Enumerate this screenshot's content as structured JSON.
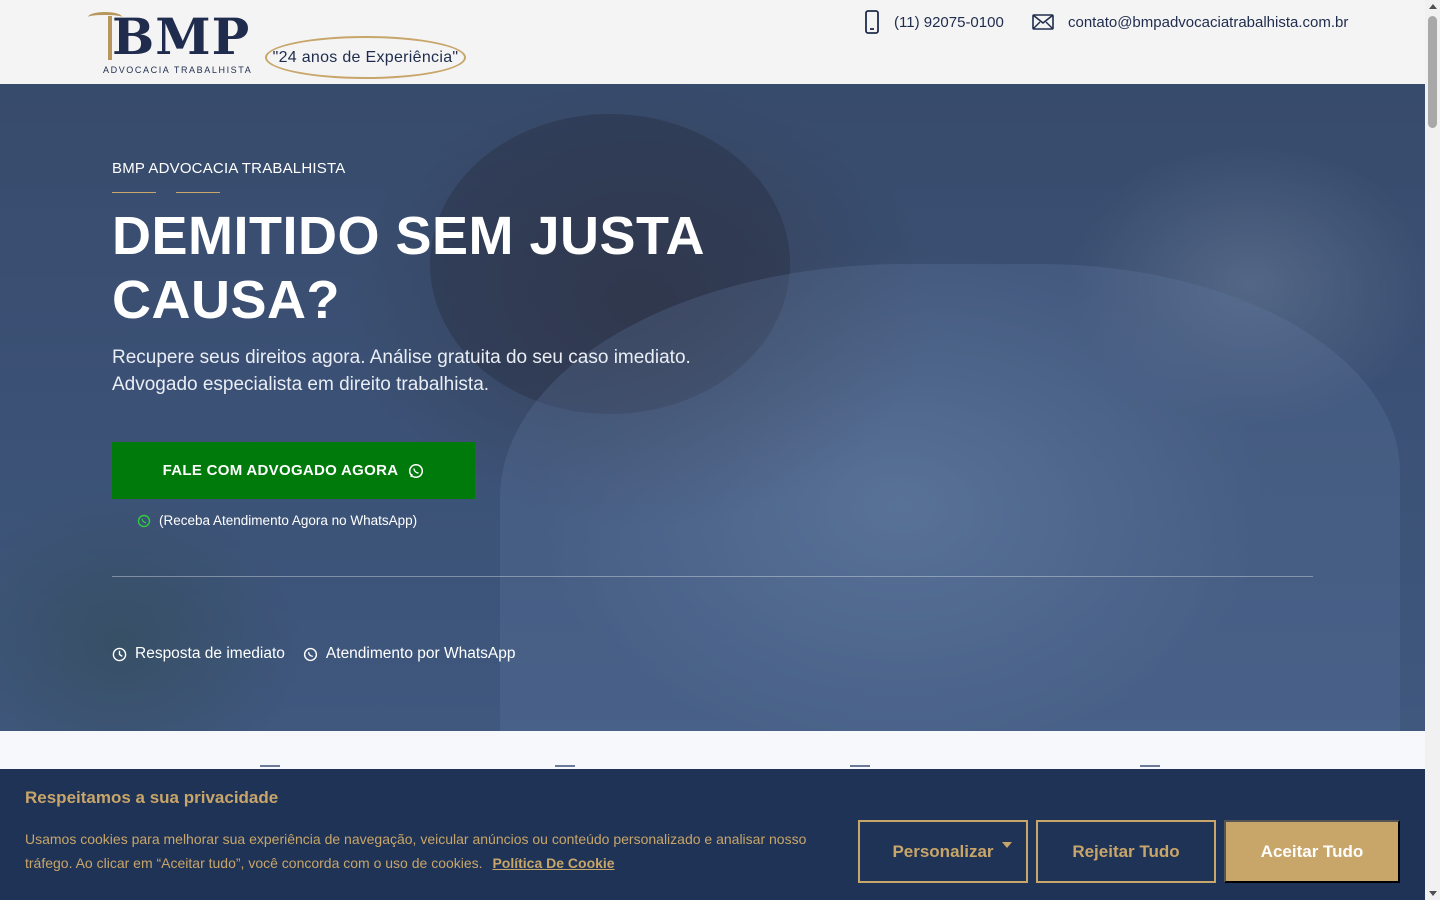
{
  "header": {
    "logo_text": "BMP",
    "logo_subtitle": "ADVOCACIA TRABALHISTA",
    "experience_badge": "\"24 anos de Experiência\"",
    "phone": "(11) 92075-0100",
    "email": "contato@bmpadvocaciatrabalhista.com.br"
  },
  "hero": {
    "eyebrow": "BMP ADVOCACIA TRABALHISTA",
    "headline": "DEMITIDO SEM JUSTA CAUSA?",
    "subtext": "Recupere seus direitos agora. Análise gratuita do seu caso imediato. Advogado especialista em direito trabalhista.",
    "cta_label": "FALE COM ADVOGADO AGORA",
    "cta_note": "(Receba Atendimento Agora no WhatsApp)",
    "features": [
      {
        "icon": "clock-icon",
        "label": "Resposta de imediato"
      },
      {
        "icon": "whatsapp-icon",
        "label": "Atendimento por WhatsApp"
      }
    ]
  },
  "cookie_banner": {
    "title": "Respeitamos a sua privacidade",
    "text": "Usamos cookies para melhorar sua experiência de navegação, veicular anúncios ou conteúdo personalizado e analisar nosso tráfego. Ao clicar em “Aceitar tudo”, você concorda com o uso de cookies.",
    "policy_link": "Política De Cookie",
    "buttons": {
      "customize": "Personalizar",
      "reject": "Rejeitar Tudo",
      "accept": "Aceitar Tudo"
    }
  },
  "colors": {
    "navy": "#1f2c4d",
    "gold": "#c8a569",
    "cta_green": "#007a0a",
    "banner_bg": "#1f3356"
  }
}
